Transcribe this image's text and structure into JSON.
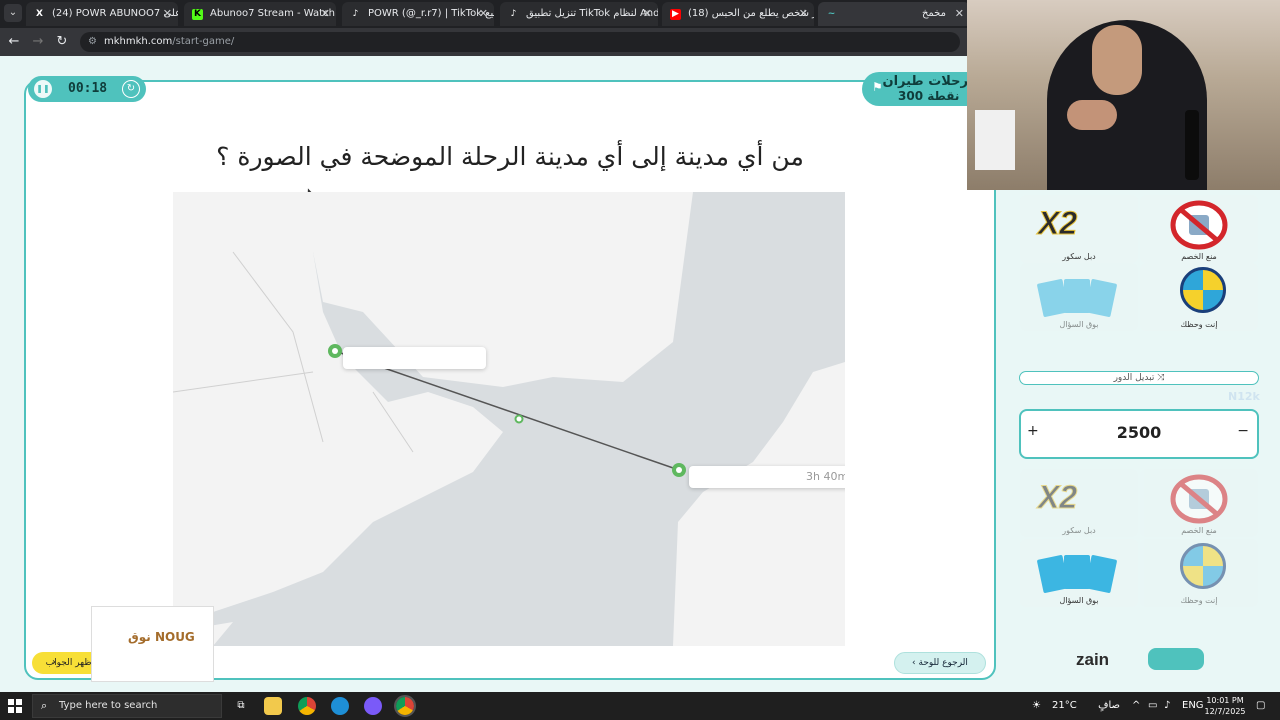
{
  "browser": {
    "tabs": [
      {
        "title": "(24) POWR ABUNOO7 على X: \"",
        "favicon": "X",
        "active": false
      },
      {
        "title": "Abunoo7 Stream - Watch Live o",
        "favicon": "K",
        "active": false
      },
      {
        "title": "POWR (@_r.r7) | TikTok أبو سبيع",
        "favicon": "♪",
        "active": false
      },
      {
        "title": "تنزيل تطبيق TikTok لنظام Android",
        "favicon": "♪",
        "active": false
      },
      {
        "title": "(18) اخر شخص يطلع من الحبس ||",
        "favicon": "▶",
        "active": false
      },
      {
        "title": "مخمخ",
        "favicon": "~",
        "active": true
      }
    ],
    "url_site": "mkhmkh.com",
    "url_path": "/start-game/"
  },
  "game": {
    "timer": "00:18",
    "category_name": "رحلات طيران",
    "category_points": "300 نقطة",
    "question": "من أي مدينة إلى أي مدينة الرحلة الموضحة في الصورة ؟",
    "flight_duration": "3h 40m",
    "answer_button": "اظهر الجواب",
    "back_button": "الرجوع للوحة",
    "brand_logo": "نوق NOUG"
  },
  "panel": {
    "tools_top": [
      {
        "label": "دبل سكور",
        "icon": "x2-icon"
      },
      {
        "label": "منع الخصم",
        "icon": "no-entry-icon"
      },
      {
        "label": "بوق السؤال",
        "icon": "cards-icon"
      },
      {
        "label": "إنت وحظك",
        "icon": "wheel-icon"
      }
    ],
    "swap_turn": "تبديل الدور",
    "team_name": "N12k",
    "score": "2500",
    "plus": "+",
    "minus": "−",
    "tools_bottom": [
      {
        "label": "دبل سكور",
        "icon": "x2-icon"
      },
      {
        "label": "منع الخصم",
        "icon": "no-entry-icon"
      },
      {
        "label": "بوق السؤال",
        "icon": "cards-icon"
      },
      {
        "label": "إنت وحظك",
        "icon": "wheel-icon"
      }
    ],
    "sponsor": "zain"
  },
  "taskbar": {
    "search_placeholder": "Type here to search",
    "weather": "21°C",
    "weather_text": "صافٍ غالبًا",
    "lang": "ENG",
    "time": "10:01 PM",
    "date": "12/7/2025"
  },
  "colors": {
    "accent": "#4fc2bd",
    "answer_yellow": "#f7df37",
    "route_green": "#5fb85f"
  }
}
